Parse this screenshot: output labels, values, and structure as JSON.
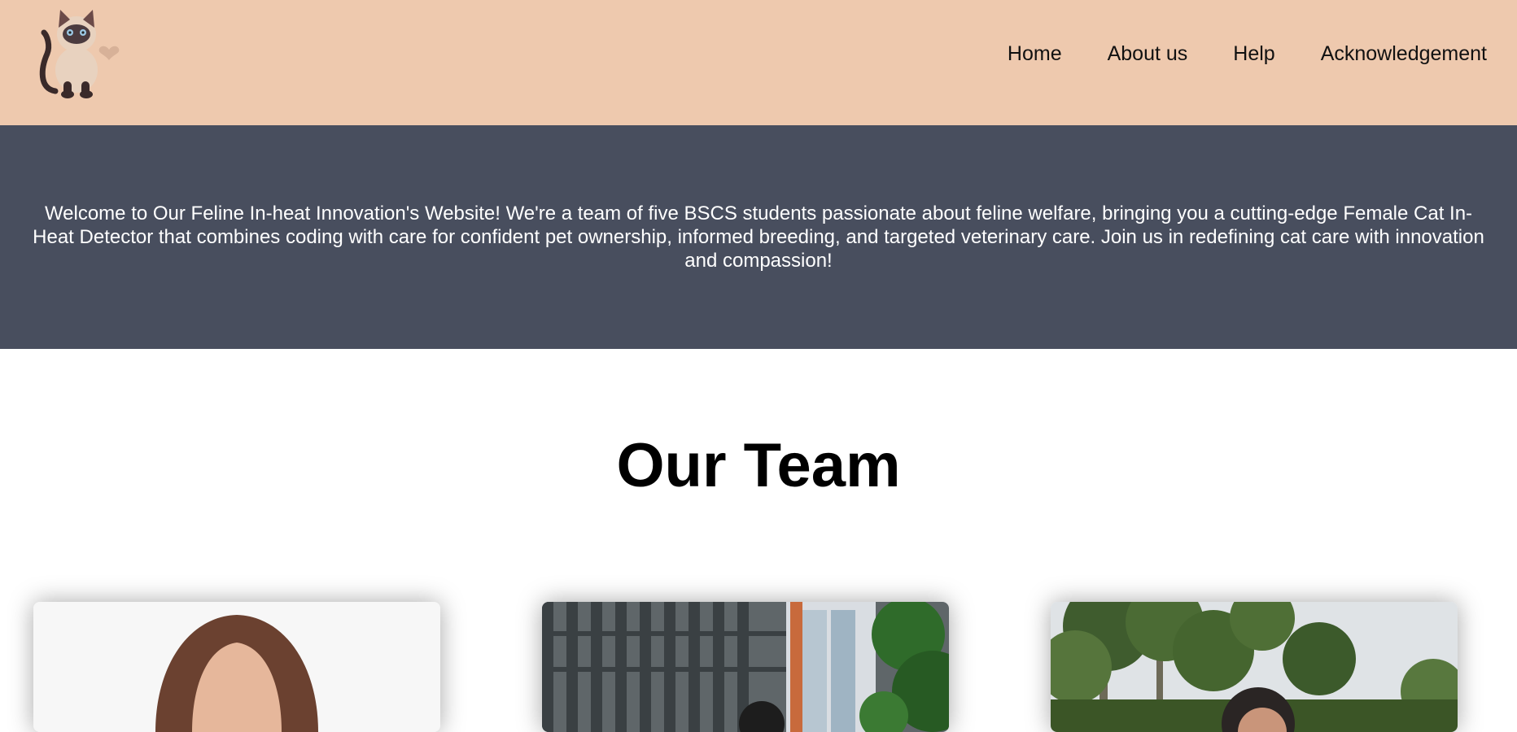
{
  "header": {
    "logo_icon": "cat-logo-icon",
    "nav": [
      {
        "label": "Home"
      },
      {
        "label": "About us"
      },
      {
        "label": "Help"
      },
      {
        "label": "Acknowledgement"
      }
    ]
  },
  "hero": {
    "text": "Welcome to Our Feline In-heat Innovation's Website! We're a team of five BSCS students passionate about feline welfare, bringing you a cutting-edge Female Cat In-Heat Detector that combines coding with care for confident pet ownership, informed breeding, and targeted veterinary care. Join us in redefining cat care with innovation and compassion!"
  },
  "team": {
    "title": "Our Team",
    "members": [
      {
        "photo": "team-member-photo"
      },
      {
        "photo": "team-member-photo"
      },
      {
        "photo": "team-member-photo"
      }
    ]
  },
  "colors": {
    "header_bg": "#eec9ae",
    "hero_bg": "#484e5e",
    "hero_text": "#ffffff"
  }
}
